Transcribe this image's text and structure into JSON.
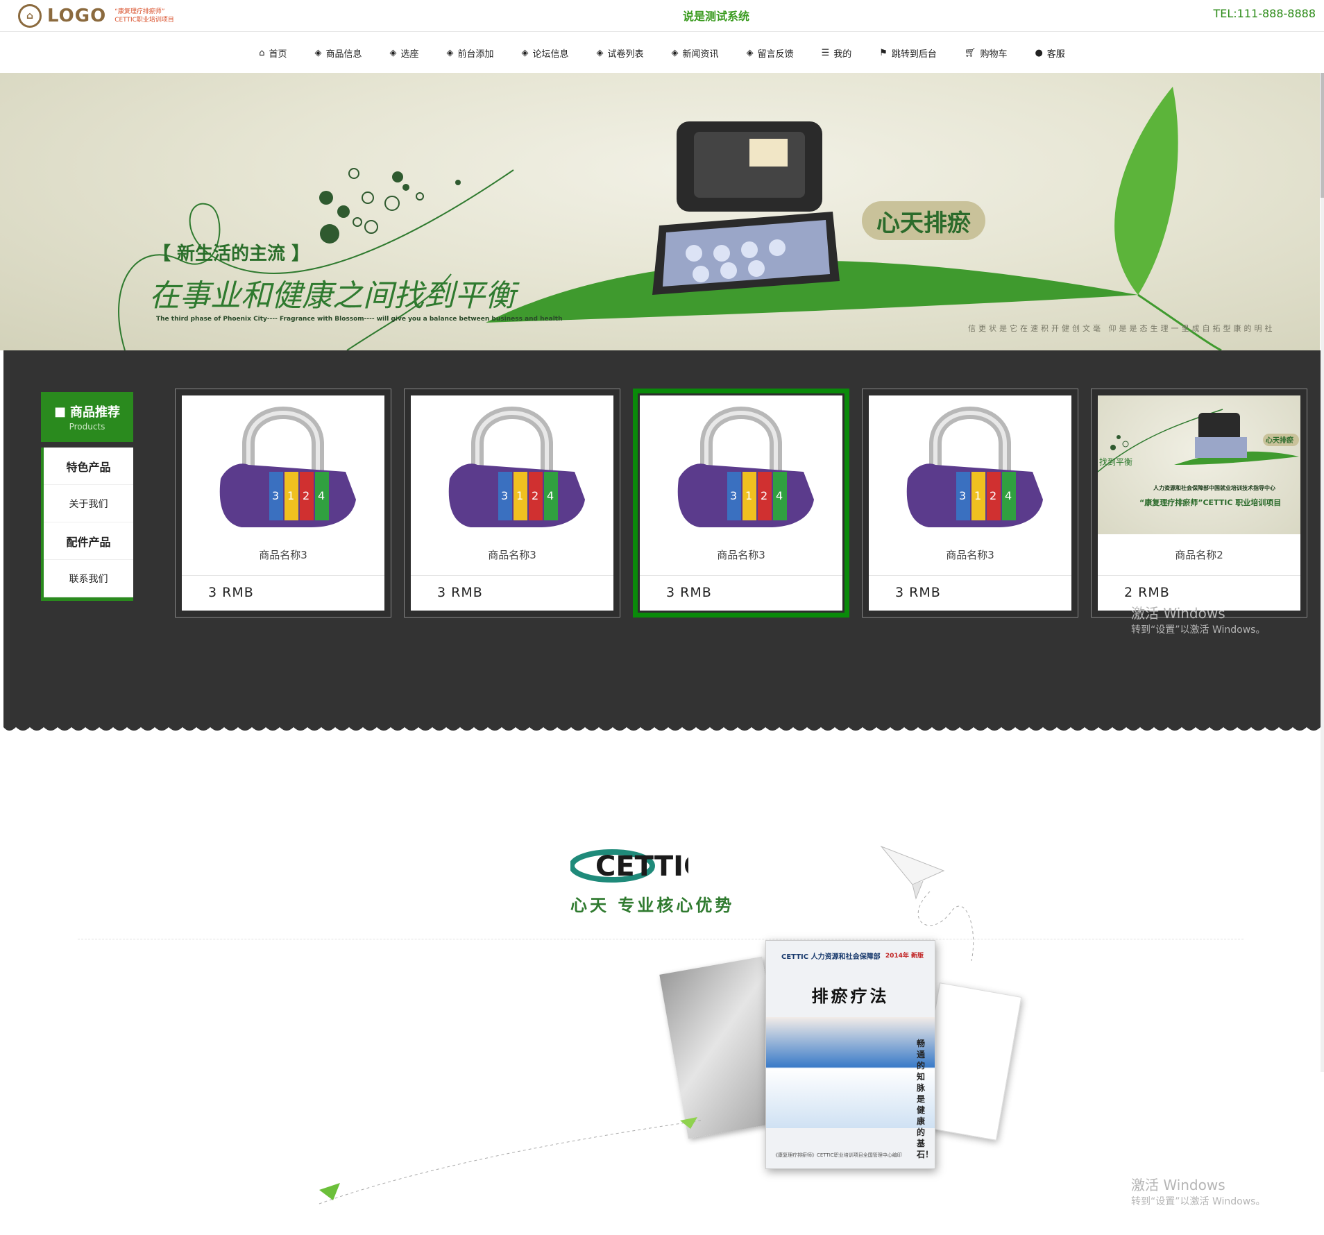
{
  "header": {
    "logo_text": "LOGO",
    "logo_sub_1": "“康复理疗排瘀师”",
    "logo_sub_2": "CETTIC职业培训项目",
    "site_title": "说是测试系统",
    "tel": "TEL:111-888-8888"
  },
  "nav": {
    "items": [
      {
        "label": "首页",
        "icon": "home-icon"
      },
      {
        "label": "商品信息",
        "icon": "stack-icon"
      },
      {
        "label": "选座",
        "icon": "stack-icon"
      },
      {
        "label": "前台添加",
        "icon": "stack-icon"
      },
      {
        "label": "论坛信息",
        "icon": "stack-icon"
      },
      {
        "label": "试卷列表",
        "icon": "stack-icon"
      },
      {
        "label": "新闻资讯",
        "icon": "stack-icon"
      },
      {
        "label": "留言反馈",
        "icon": "stack-icon"
      },
      {
        "label": "我的",
        "icon": "list-icon"
      },
      {
        "label": "跳转到后台",
        "icon": "flag-icon"
      },
      {
        "label": "购物车",
        "icon": "cart-icon"
      },
      {
        "label": "客服",
        "icon": "support-icon"
      }
    ]
  },
  "banner": {
    "tag": "【 新生活的主流 】",
    "slogan": "在事业和健康之间找到平衡",
    "english": "The third phase of Phoenix City---- Fragrance with Blossom---- will give you a balance between business and health",
    "badge": "心天排瘀",
    "vertical_text": "信更状是它在速积开健创文毫 仰是是态生理一里成自拓型康的明社"
  },
  "sidebar": {
    "title": "商品推荐",
    "subtitle": "Products",
    "items": [
      {
        "label": "特色产品",
        "bold": true
      },
      {
        "label": "关于我们",
        "bold": false
      },
      {
        "label": "配件产品",
        "bold": true
      },
      {
        "label": "联系我们",
        "bold": false
      }
    ]
  },
  "products": [
    {
      "name": "商品名称3",
      "price": "3 RMB",
      "image": "combination-lock",
      "active": false
    },
    {
      "name": "商品名称3",
      "price": "3 RMB",
      "image": "combination-lock",
      "active": false
    },
    {
      "name": "商品名称3",
      "price": "3 RMB",
      "image": "combination-lock",
      "active": true
    },
    {
      "name": "商品名称3",
      "price": "3 RMB",
      "image": "combination-lock",
      "active": false
    },
    {
      "name": "商品名称2",
      "price": "2 RMB",
      "image": "banner-thumbnail",
      "active": false
    }
  ],
  "product_thumb_text": {
    "badge": "心天排瘀",
    "slogan": "找到平衡",
    "line1": "人力资源和社会保障部中国就业培训技术指导中心",
    "line2": "“康复理疗排瘀师”CETTIC 职业培训项目"
  },
  "watermark": {
    "line1": "激活 Windows",
    "line2": "转到“设置”以激活 Windows。"
  },
  "advantage": {
    "brand": "CETTIC",
    "title": "心天    专业核心优势"
  },
  "book": {
    "brand": "CETTIC 人力资源和社会保障部",
    "year": "2014年 新版",
    "title": "排瘀疗法",
    "poem": "畅通的知脉是健康的基石！",
    "footer": "《康复理疗排瘀师》CETTIC职业培训项目全国管理中心编印"
  },
  "colors": {
    "brand_green": "#2a8a1e",
    "dark_bg": "#333333",
    "active_border": "#0a8a0a",
    "logo_brown": "#8b6a3e"
  }
}
